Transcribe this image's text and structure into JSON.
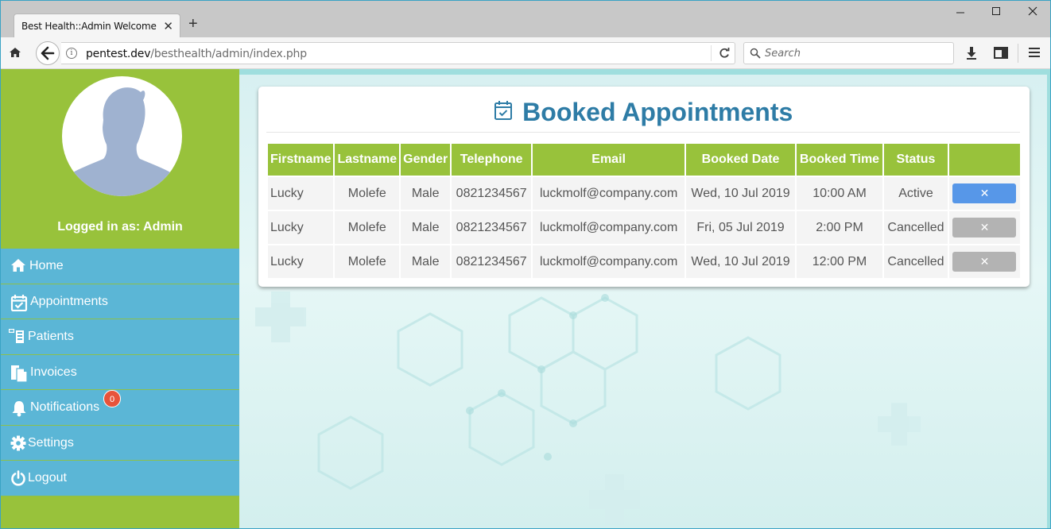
{
  "browser": {
    "tab_title": "Best Health::Admin Welcome",
    "tab_close": "✕",
    "new_tab": "+",
    "url_host": "pentest.dev",
    "url_path": "/besthealth/admin/index.php",
    "search_placeholder": "Search",
    "window_controls": {
      "minimize": "—",
      "maximize": "☐",
      "close": "✕"
    }
  },
  "sidebar": {
    "logged_in_text": "Logged in as: Admin",
    "items": [
      {
        "label": "Home",
        "icon": "home-icon"
      },
      {
        "label": "Appointments",
        "icon": "calendar-check-icon"
      },
      {
        "label": "Patients",
        "icon": "patients-icon"
      },
      {
        "label": "Invoices",
        "icon": "invoices-icon"
      },
      {
        "label": "Notifications",
        "icon": "bell-icon",
        "badge": "0"
      },
      {
        "label": "Settings",
        "icon": "gear-icon"
      },
      {
        "label": "Logout",
        "icon": "power-icon"
      }
    ]
  },
  "main": {
    "title": "Booked Appointments",
    "columns": [
      "Firstname",
      "Lastname",
      "Gender",
      "Telephone",
      "Email",
      "Booked Date",
      "Booked Time",
      "Status",
      ""
    ],
    "rows": [
      {
        "firstname": "Lucky",
        "lastname": "Molefe",
        "gender": "Male",
        "telephone": "0821234567",
        "email": "luckmolf@company.com",
        "date": "Wed, 10 Jul 2019",
        "time": "10:00 AM",
        "status": "Active",
        "action": "✕"
      },
      {
        "firstname": "Lucky",
        "lastname": "Molefe",
        "gender": "Male",
        "telephone": "0821234567",
        "email": "luckmolf@company.com",
        "date": "Fri, 05 Jul 2019",
        "time": "2:00 PM",
        "status": "Cancelled",
        "action": "✕"
      },
      {
        "firstname": "Lucky",
        "lastname": "Molefe",
        "gender": "Male",
        "telephone": "0821234567",
        "email": "luckmolf@company.com",
        "date": "Wed, 10 Jul 2019",
        "time": "12:00 PM",
        "status": "Cancelled",
        "action": "✕"
      }
    ]
  },
  "colors": {
    "sidebar_green": "#98c23b",
    "menu_blue": "#5bb6d6",
    "title_blue": "#2e7ca6",
    "badge_red": "#e8533b",
    "action_active": "#5797e8",
    "action_disabled": "#b3b3b3"
  }
}
